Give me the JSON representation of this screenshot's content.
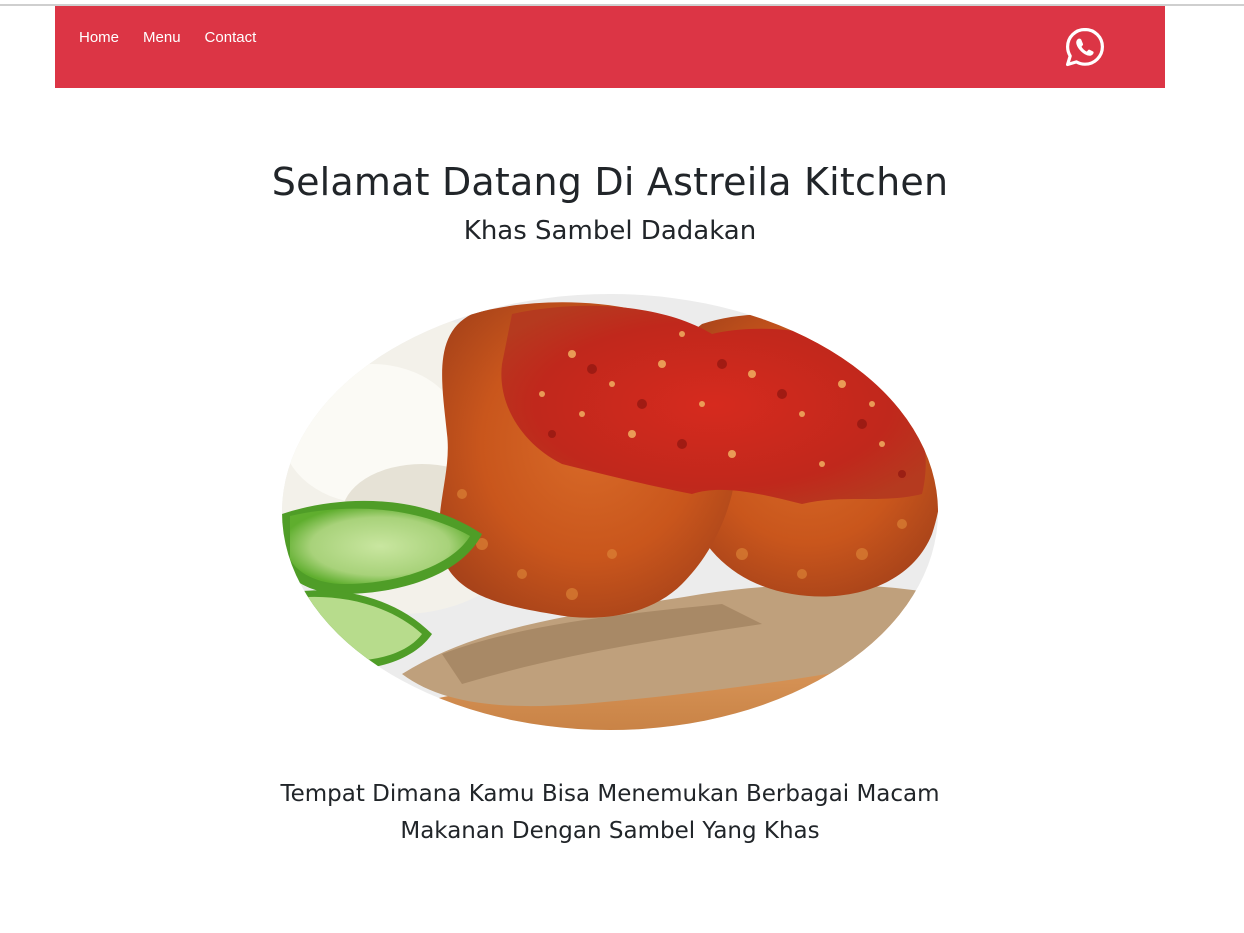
{
  "nav": {
    "links": [
      "Home",
      "Menu",
      "Contact"
    ],
    "contact_icon": "whatsapp-icon"
  },
  "hero": {
    "title": "Selamat Datang Di Astreila Kitchen",
    "subtitle": "Khas Sambel Dadakan",
    "image_icon": "fried-chicken-sambal-photo"
  },
  "tagline": {
    "line1": "Tempat Dimana Kamu Bisa Menemukan Berbagai Macam",
    "line2": "Makanan Dengan Sambel Yang Khas"
  },
  "colors": {
    "navbar": "#dc3545",
    "text": "#212529",
    "nav_text": "#ffffff"
  }
}
